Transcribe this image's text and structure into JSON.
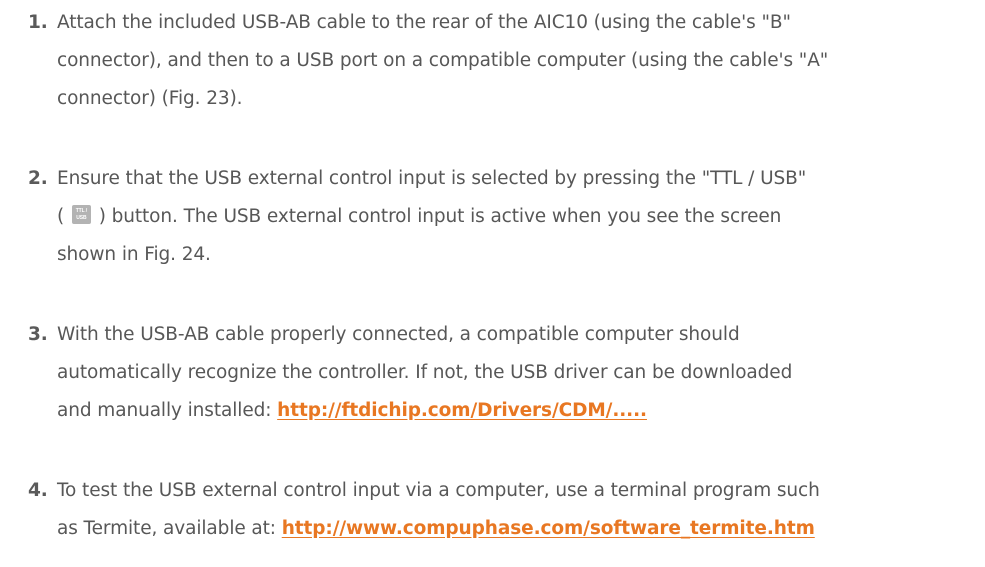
{
  "steps": [
    {
      "number": "1.",
      "lines": [
        "Attach the included USB-AB cable to the rear of the AIC10 (using the cable's \"B\"",
        "connector), and then to a USB port on a compatible computer (using the cable's \"A\"",
        "connector) (Fig. 23)."
      ]
    },
    {
      "number": "2.",
      "line1": "Ensure that the USB external control input is selected by pressing the \"TTL / USB\"",
      "line2_before": "(",
      "line2_after": ") button. The USB external control input is active when you see the screen",
      "line3": "shown in Fig. 24.",
      "icon": {
        "name": "ttl-usb-button-icon",
        "top_text": "TTL /",
        "bottom_text": "USB",
        "color": "#b3b3b3"
      }
    },
    {
      "number": "3.",
      "line1": "With the USB-AB cable properly connected, a compatible computer should",
      "line2": "automatically recognize the controller. If not, the USB driver can be downloaded",
      "line3_prefix": "and manually installed: ",
      "link": "http://ftdichip.com/Drivers/CDM/....."
    },
    {
      "number": "4.",
      "line1": "To test the USB external control input via a computer, use a terminal program such",
      "line2_prefix": "as Termite, available at: ",
      "link": "http://www.compuphase.com/software_termite.htm"
    }
  ],
  "colors": {
    "text": "#575757",
    "link": "#e87722",
    "icon_bg": "#b3b3b3"
  }
}
